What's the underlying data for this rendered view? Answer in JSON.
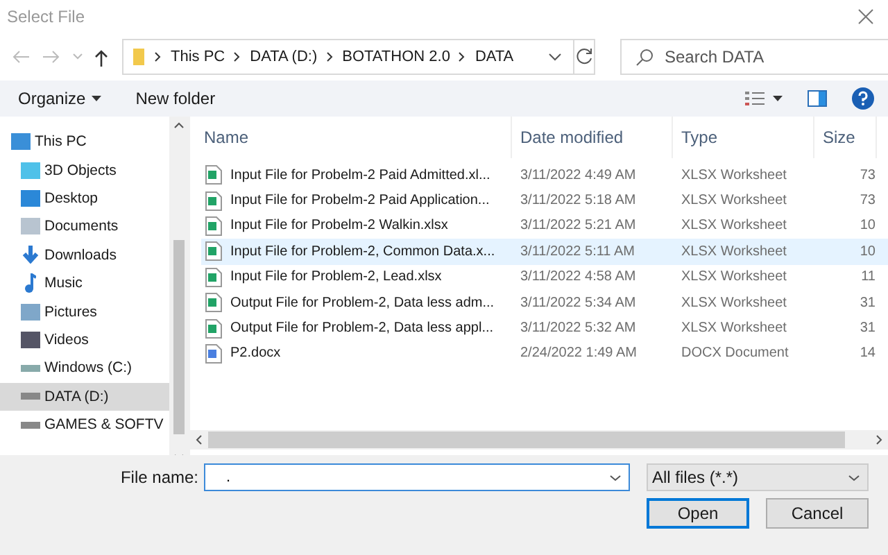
{
  "window": {
    "title": "Select File"
  },
  "breadcrumb": [
    "This PC",
    "DATA (D:)",
    "BOTATHON 2.0",
    "DATA"
  ],
  "search": {
    "placeholder": "Search DATA"
  },
  "toolbar": {
    "organize": "Organize",
    "new_folder": "New folder"
  },
  "sidebar": {
    "items": [
      {
        "label": "This PC",
        "kind": "pc",
        "selected": false
      },
      {
        "label": "3D Objects",
        "kind": "cube",
        "selected": false
      },
      {
        "label": "Desktop",
        "kind": "desktop",
        "selected": false
      },
      {
        "label": "Documents",
        "kind": "doc",
        "selected": false
      },
      {
        "label": "Downloads",
        "kind": "download",
        "selected": false
      },
      {
        "label": "Music",
        "kind": "music",
        "selected": false
      },
      {
        "label": "Pictures",
        "kind": "picture",
        "selected": false
      },
      {
        "label": "Videos",
        "kind": "video",
        "selected": false
      },
      {
        "label": "Windows (C:)",
        "kind": "windrive",
        "selected": false
      },
      {
        "label": "DATA (D:)",
        "kind": "drive",
        "selected": true
      },
      {
        "label": "GAMES & SOFTV",
        "kind": "drive",
        "selected": false
      }
    ]
  },
  "table": {
    "columns": [
      "Name",
      "Date modified",
      "Type",
      "Size"
    ],
    "rows": [
      {
        "name": "Input File for Probelm-2 Paid Admitted.xl...",
        "date": "3/11/2022 4:49 AM",
        "type": "XLSX Worksheet",
        "size": "73",
        "kind": "xlsx",
        "selected": false
      },
      {
        "name": "Input File for Probelm-2 Paid Application...",
        "date": "3/11/2022 5:18 AM",
        "type": "XLSX Worksheet",
        "size": "73",
        "kind": "xlsx",
        "selected": false
      },
      {
        "name": "Input File for Probelm-2 Walkin.xlsx",
        "date": "3/11/2022 5:21 AM",
        "type": "XLSX Worksheet",
        "size": "10",
        "kind": "xlsx",
        "selected": false
      },
      {
        "name": "Input File for Problem-2, Common Data.x...",
        "date": "3/11/2022 5:11 AM",
        "type": "XLSX Worksheet",
        "size": "10",
        "kind": "xlsx",
        "selected": true
      },
      {
        "name": "Input File for Problem-2, Lead.xlsx",
        "date": "3/11/2022 4:58 AM",
        "type": "XLSX Worksheet",
        "size": "11",
        "kind": "xlsx",
        "selected": false
      },
      {
        "name": "Output File for Problem-2, Data less adm...",
        "date": "3/11/2022 5:34 AM",
        "type": "XLSX Worksheet",
        "size": "31",
        "kind": "xlsx",
        "selected": false
      },
      {
        "name": "Output File for Problem-2, Data less appl...",
        "date": "3/11/2022 5:32 AM",
        "type": "XLSX Worksheet",
        "size": "31",
        "kind": "xlsx",
        "selected": false
      },
      {
        "name": "P2.docx",
        "date": "2/24/2022 1:49 AM",
        "type": "DOCX Document",
        "size": "14",
        "kind": "docx",
        "selected": false
      }
    ]
  },
  "file_name": {
    "label": "File name:",
    "value": "."
  },
  "file_type": {
    "value": "All files (*.*)"
  },
  "buttons": {
    "open": "Open",
    "cancel": "Cancel"
  }
}
